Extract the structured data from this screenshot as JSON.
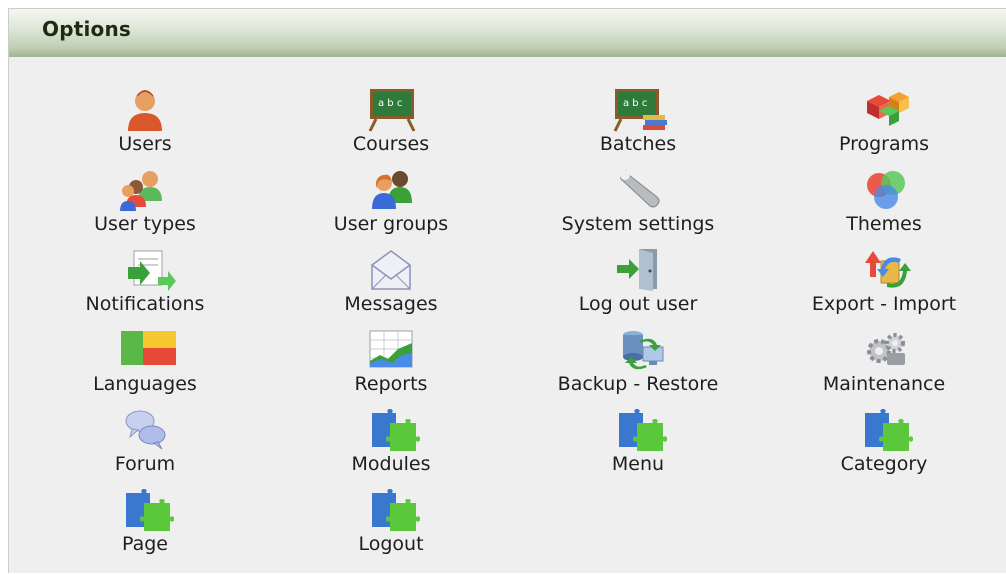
{
  "header": {
    "title": "Options"
  },
  "options": [
    {
      "label": "Users",
      "icon": "user-icon"
    },
    {
      "label": "Courses",
      "icon": "chalkboard-icon"
    },
    {
      "label": "Batches",
      "icon": "chalkboard-books-icon"
    },
    {
      "label": "Programs",
      "icon": "cubes-icon"
    },
    {
      "label": "User types",
      "icon": "user-types-icon"
    },
    {
      "label": "User groups",
      "icon": "user-group-icon"
    },
    {
      "label": "System settings",
      "icon": "wrench-icon"
    },
    {
      "label": "Themes",
      "icon": "color-circles-icon"
    },
    {
      "label": "Notifications",
      "icon": "notification-icon"
    },
    {
      "label": "Messages",
      "icon": "envelope-icon"
    },
    {
      "label": "Log out user",
      "icon": "logout-door-icon"
    },
    {
      "label": "Export - Import",
      "icon": "export-import-icon"
    },
    {
      "label": "Languages",
      "icon": "flag-icon"
    },
    {
      "label": "Reports",
      "icon": "chart-icon"
    },
    {
      "label": "Backup - Restore",
      "icon": "backup-icon"
    },
    {
      "label": "Maintenance",
      "icon": "gears-icon"
    },
    {
      "label": "Forum",
      "icon": "speech-bubbles-icon"
    },
    {
      "label": "Modules",
      "icon": "puzzle-icon"
    },
    {
      "label": "Menu",
      "icon": "puzzle-icon"
    },
    {
      "label": "Category",
      "icon": "puzzle-icon"
    },
    {
      "label": "Page",
      "icon": "puzzle-icon"
    },
    {
      "label": "Logout",
      "icon": "puzzle-icon"
    }
  ]
}
